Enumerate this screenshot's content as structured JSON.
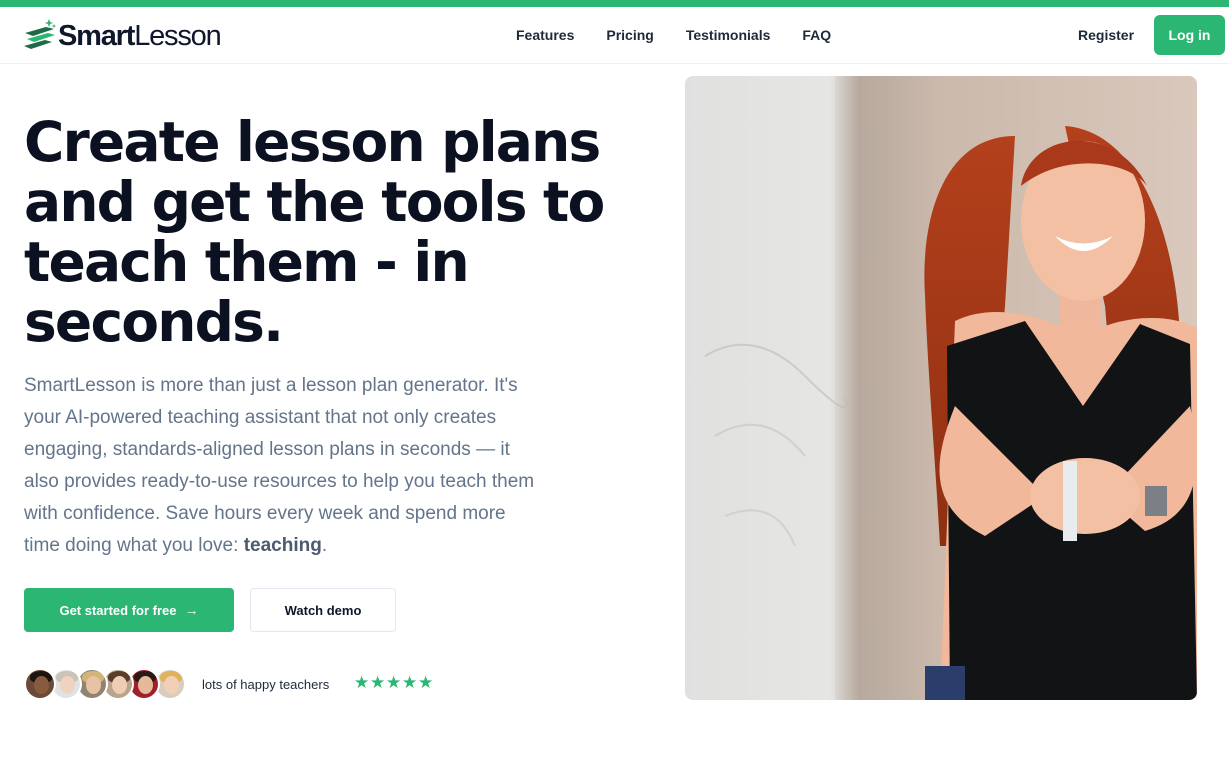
{
  "brand": {
    "name_part1": "Smart",
    "name_part2": "Lesson",
    "accent_color": "#2bb673"
  },
  "nav": {
    "links": [
      "Features",
      "Pricing",
      "Testimonials",
      "FAQ"
    ],
    "register_label": "Register",
    "login_label": "Log in"
  },
  "hero": {
    "headline": "Create lesson plans and get the tools to teach them - in seconds.",
    "description_main": "SmartLesson is more than just a lesson plan generator. It's your AI-powered teaching assistant that not only creates engaging, standards-aligned lesson plans in seconds — it also provides ready-to-use resources to help you teach them with confidence. Save hours every week and spend more time doing what you love: ",
    "description_emphasis": "teaching",
    "description_end": ".",
    "cta_primary_label": "Get started for free",
    "cta_primary_icon": "arrow-right-icon",
    "cta_secondary_label": "Watch demo"
  },
  "social_proof": {
    "text": "lots of happy teachers",
    "rating_stars": 5,
    "avatar_count": 6
  }
}
